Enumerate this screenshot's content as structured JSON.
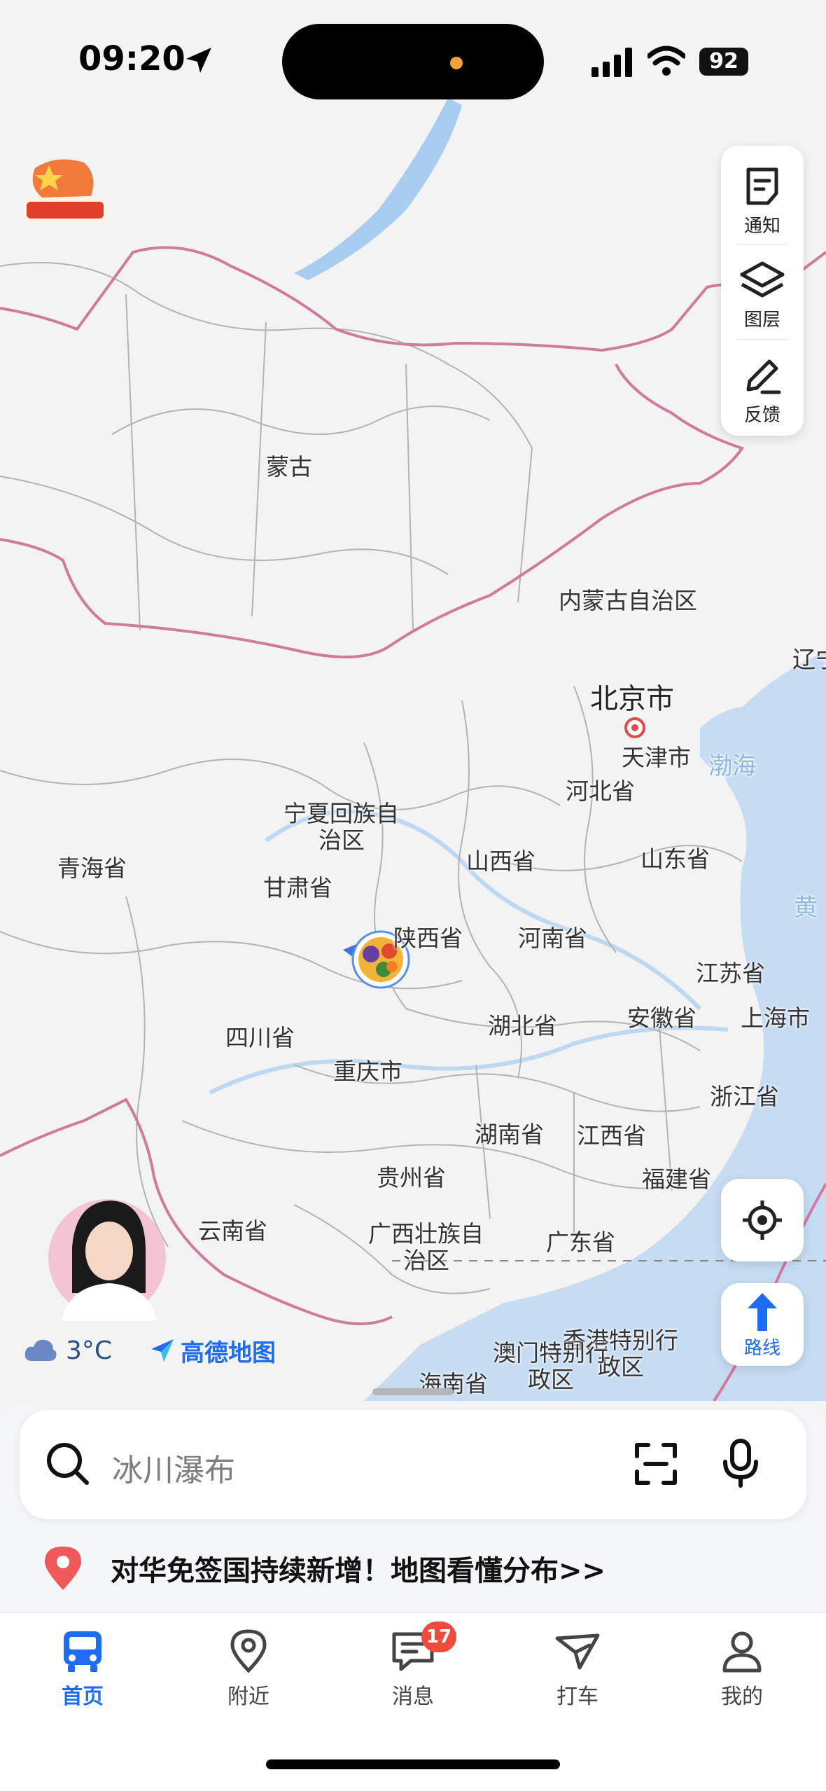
{
  "status_bar": {
    "time": "09:20",
    "battery": "92"
  },
  "map": {
    "labels": {
      "mongolia": "蒙古",
      "inner_mongolia": "内蒙古自治区",
      "liaoning": "辽宁",
      "beijing": "北京市",
      "tianjin": "天津市",
      "hebei": "河北省",
      "bohai": "渤海",
      "ningxia_line1": "宁夏回族自",
      "ningxia_line2": "治区",
      "qinghai": "青海省",
      "gansu": "甘肃省",
      "shanxi": "山西省",
      "shandong": "山东省",
      "huanghai": "黄",
      "shaanxi": "陕西省",
      "henan": "河南省",
      "jiangsu": "江苏省",
      "sichuan": "四川省",
      "hubei": "湖北省",
      "anhui": "安徽省",
      "shanghai": "上海市",
      "chongqing": "重庆市",
      "zhejiang": "浙江省",
      "hunan": "湖南省",
      "jiangxi": "江西省",
      "guizhou": "贵州省",
      "fujian": "福建省",
      "yunnan": "云南省",
      "guangxi_line1": "广西壮族自",
      "guangxi_line2": "治区",
      "guangdong": "广东省",
      "macau_line1": "澳门特别行",
      "macau_line2": "政区",
      "hk_line1": "香港特别行",
      "hk_line2": "政区",
      "hainan": "海南省"
    }
  },
  "tools": {
    "notify": "通知",
    "layers": "图层",
    "feedback": "反馈"
  },
  "route_label": "路线",
  "weather": {
    "temp": "3°C",
    "brand": "高德地图"
  },
  "search": {
    "placeholder": "冰川瀑布"
  },
  "news": {
    "text": "对华免签国持续新增！地图看懂分布>>"
  },
  "tabs": [
    {
      "label": "首页"
    },
    {
      "label": "附近"
    },
    {
      "label": "消息",
      "badge": "17"
    },
    {
      "label": "打车"
    },
    {
      "label": "我的"
    }
  ],
  "colors": {
    "accent": "#1d6cf2",
    "badge": "#f04a3b",
    "border": "#d07a9c"
  }
}
